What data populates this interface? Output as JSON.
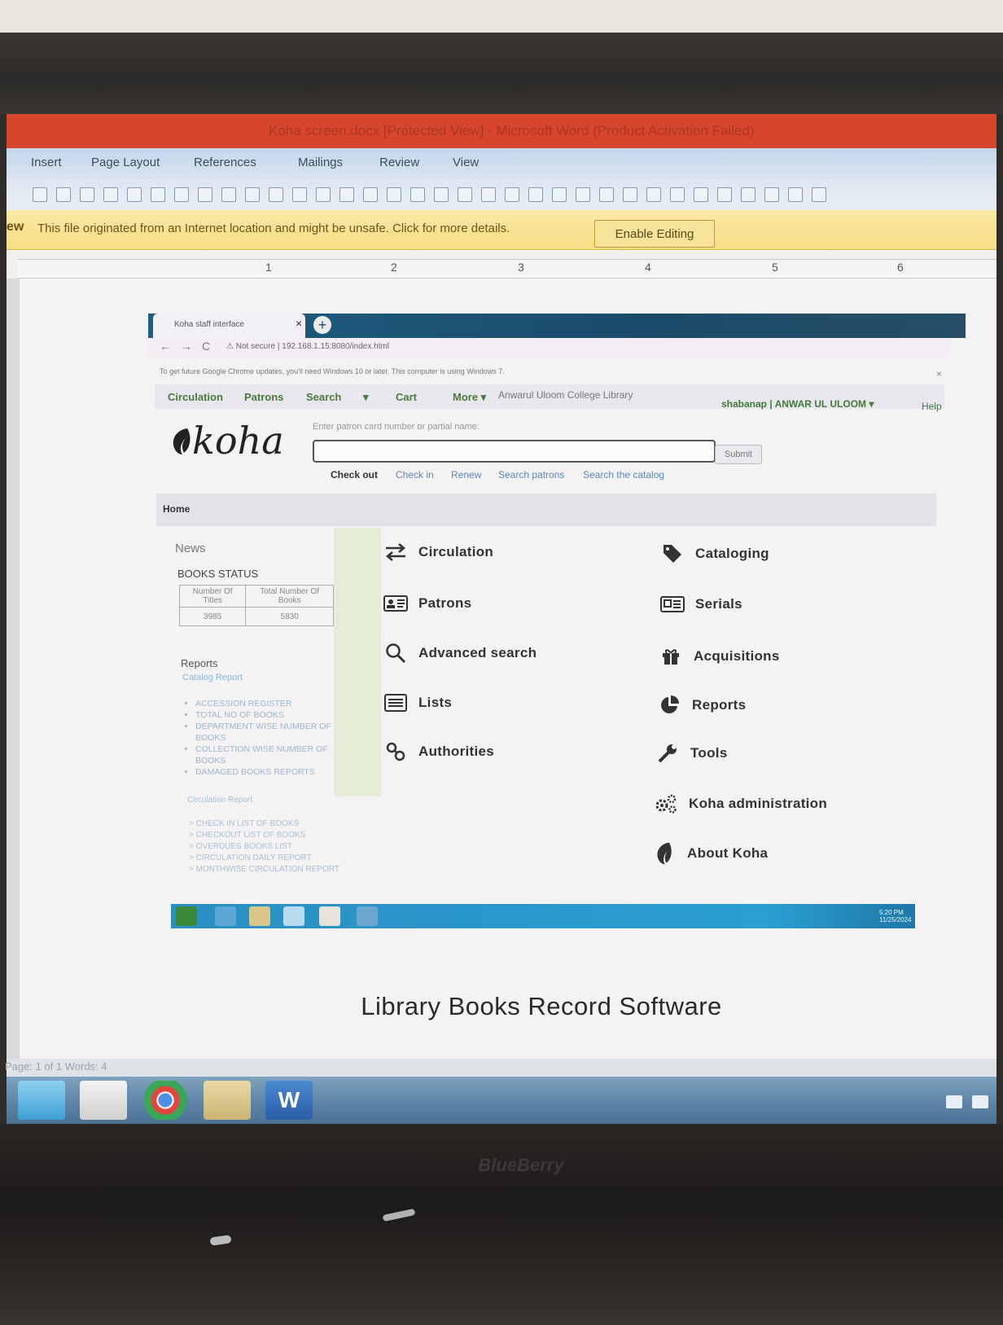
{
  "word": {
    "title": "Koha screen.docx [Protected View] - Microsoft Word (Product Activation Failed)",
    "ribbon_tabs": [
      "Insert",
      "Page Layout",
      "References",
      "Mailings",
      "Review",
      "View"
    ],
    "protected_view": {
      "tag": "ew",
      "message": "This file originated from an Internet location and might be unsafe. Click for more details.",
      "button": "Enable Editing"
    },
    "ruler_numbers": [
      "1",
      "2",
      "3",
      "4",
      "5",
      "6"
    ],
    "caption": "Library Books Record Software",
    "status": "Page: 1 of 1    Words: 4"
  },
  "monitor": {
    "brand": "BlueBerry"
  },
  "koha": {
    "browser": {
      "tab_title": "Koha staff interface",
      "tab_close": "×",
      "new_tab": "+",
      "nav": {
        "back": "←",
        "forward": "→",
        "reload": "C"
      },
      "address": "⚠ Not secure | 192.168.1.15:8080/index.html",
      "update_warning": "To get future Google Chrome updates, you'll need Windows 10 or later. This computer is using Windows 7.",
      "warning_close": "×"
    },
    "menu": {
      "items": [
        "Circulation",
        "Patrons",
        "Search",
        "▾",
        "Cart",
        "More ▾"
      ],
      "library": "Anwarul Uloom College Library",
      "user": "shabanap | ANWAR UL ULOOM ▾",
      "help": "Help"
    },
    "logo": "koha",
    "search": {
      "placeholder": "Enter patron card number or partial name:",
      "submit": "Submit",
      "subtabs": [
        "Check out",
        "Check in",
        "Renew",
        "Search patrons",
        "Search the catalog"
      ]
    },
    "breadcrumb": "Home",
    "news": {
      "title": "News",
      "books_status": "BOOKS STATUS",
      "table_headers": [
        "Number Of Titles",
        "Total Number Of Books"
      ],
      "table_values": [
        "3985",
        "5830"
      ],
      "reports_title": "Reports",
      "catalog_report": "Catalog Report",
      "catalog_items": [
        "ACCESSION REGISTER",
        "TOTAL NO OF BOOKS",
        "DEPARTMENT WISE NUMBER OF BOOKS",
        "COLLECTION WISE NUMBER OF BOOKS",
        "DAMAGED BOOKS REPORTS"
      ],
      "circulation_report": "Circulation Report",
      "circulation_items": [
        "> CHECK IN LIST OF BOOKS",
        "> CHECKOUT LIST OF BOOKS",
        "> OVERDUES BOOKS LIST",
        "> CIRCULATION DAILY REPORT",
        "> MONTHWISE CIRCULATION REPORT"
      ]
    },
    "modules_left": [
      {
        "label": "Circulation",
        "icon": "arrows-icon"
      },
      {
        "label": "Patrons",
        "icon": "id-card-icon"
      },
      {
        "label": "Advanced search",
        "icon": "search-icon"
      },
      {
        "label": "Lists",
        "icon": "list-icon"
      },
      {
        "label": "Authorities",
        "icon": "link-icon"
      }
    ],
    "modules_right": [
      {
        "label": "Cataloging",
        "icon": "tag-icon"
      },
      {
        "label": "Serials",
        "icon": "newspaper-icon"
      },
      {
        "label": "Acquisitions",
        "icon": "gift-icon"
      },
      {
        "label": "Reports",
        "icon": "pie-chart-icon"
      },
      {
        "label": "Tools",
        "icon": "wrench-icon"
      },
      {
        "label": "Koha administration",
        "icon": "gears-icon"
      },
      {
        "label": "About Koha",
        "icon": "koha-leaf-icon"
      }
    ],
    "taskbar_clock": [
      "5:20 PM",
      "11/25/2024"
    ]
  },
  "colors": {
    "word_title": "#d6452c",
    "protected_bar": "#f6dd83",
    "koha_green": "#3f7b35",
    "taskbar": "#5d84a6"
  }
}
